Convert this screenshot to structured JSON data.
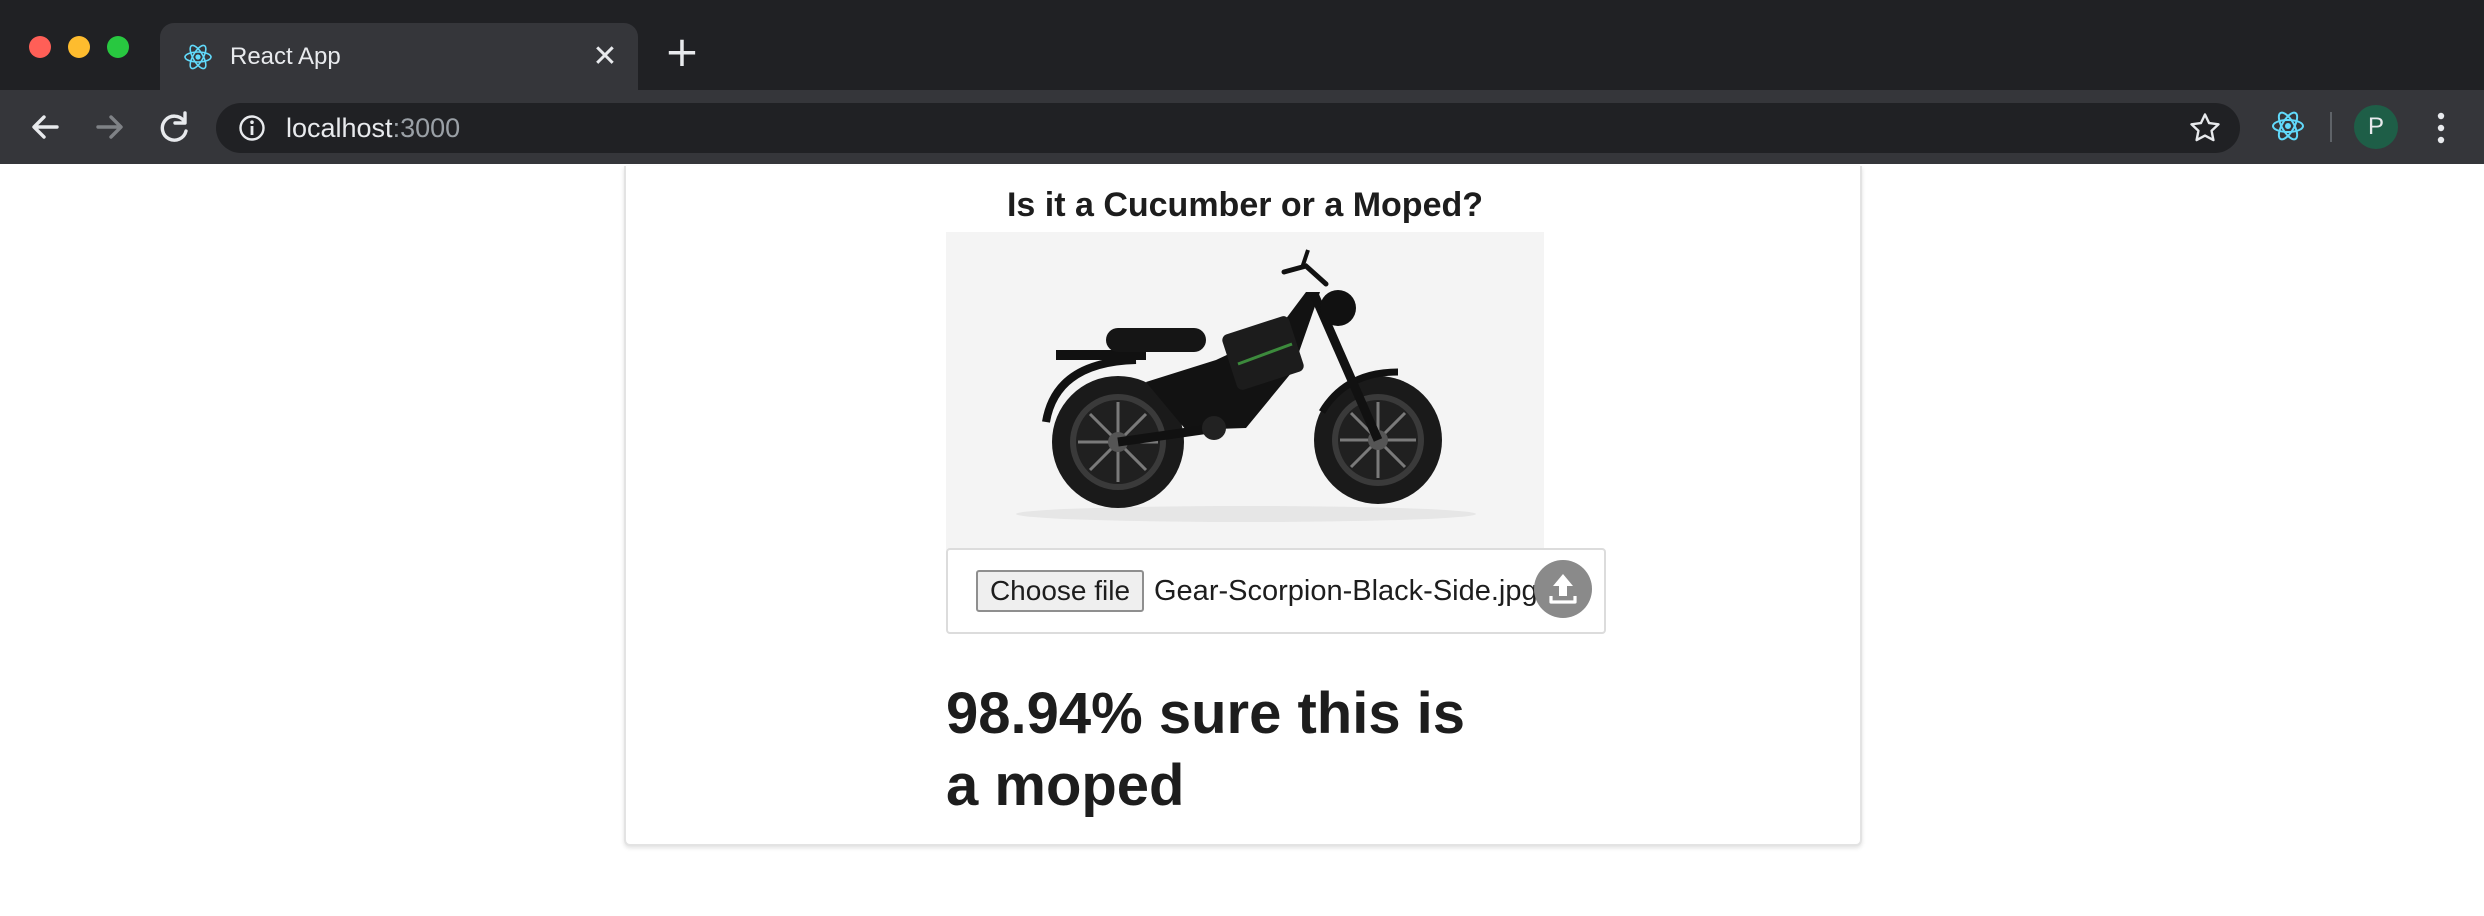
{
  "browser": {
    "tab": {
      "title": "React App",
      "close_icon": "close-icon"
    },
    "omnibox": {
      "host": "localhost",
      "port": ":3000"
    },
    "profile_initial": "P",
    "colors": {
      "chrome_dark": "#202124",
      "chrome_toolbar": "#35363a",
      "react_blue": "#61dafb",
      "avatar": "#1e5e47"
    }
  },
  "page": {
    "heading": "Is it a Cucumber or a Moped?",
    "image": {
      "subject": "black electric moped, side view"
    },
    "upload": {
      "choose_label": "Choose file",
      "file_name": "Gear-Scorpion-Black-Side.jpg",
      "upload_icon": "upload-icon"
    },
    "result": "98.94% sure this is a moped"
  }
}
